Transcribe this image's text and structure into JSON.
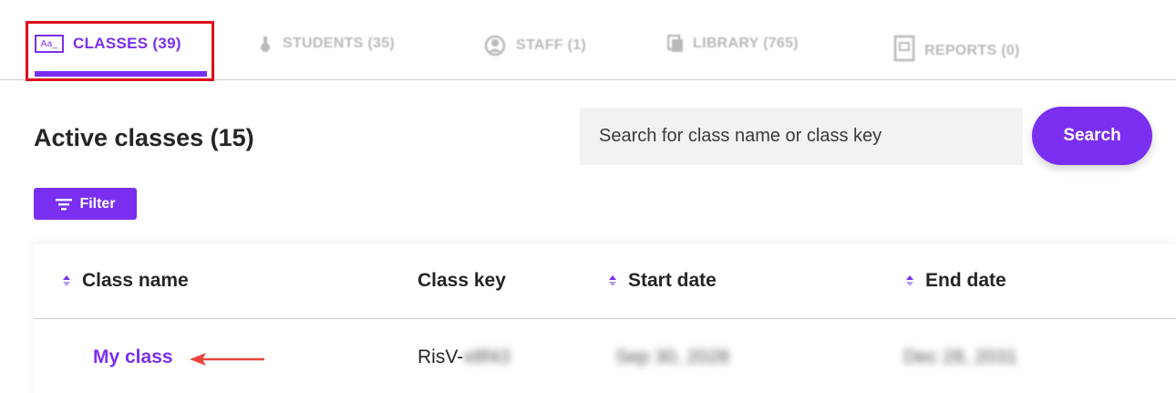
{
  "tabs": [
    {
      "label": "CLASSES (39)",
      "icon": "classes-icon",
      "active": true
    },
    {
      "label": "STUDENTS (35)",
      "icon": "student-icon",
      "active": false
    },
    {
      "label": "STAFF (1)",
      "icon": "staff-icon",
      "active": false
    },
    {
      "label": "LIBRARY (765)",
      "icon": "library-icon",
      "active": false
    },
    {
      "label": "REPORTS (0)",
      "icon": "reports-icon",
      "active": false
    }
  ],
  "classes_icon_text": "Aa_",
  "section": {
    "title": "Active classes (15)"
  },
  "search": {
    "placeholder": "Search for class name or class key",
    "button_label": "Search"
  },
  "filter": {
    "label": "Filter"
  },
  "table": {
    "columns": [
      "Class name",
      "Class key",
      "Start date",
      "End date"
    ],
    "rows": [
      {
        "class_name": "My class",
        "class_key_prefix": "RisV-",
        "class_key_hidden": "x8f43",
        "start_date": "Sep 30, 2028",
        "end_date": "Dec 28, 2031"
      }
    ]
  },
  "colors": {
    "accent": "#7a2ff0",
    "highlight": "#e0101c",
    "arrow": "#e8453c"
  }
}
